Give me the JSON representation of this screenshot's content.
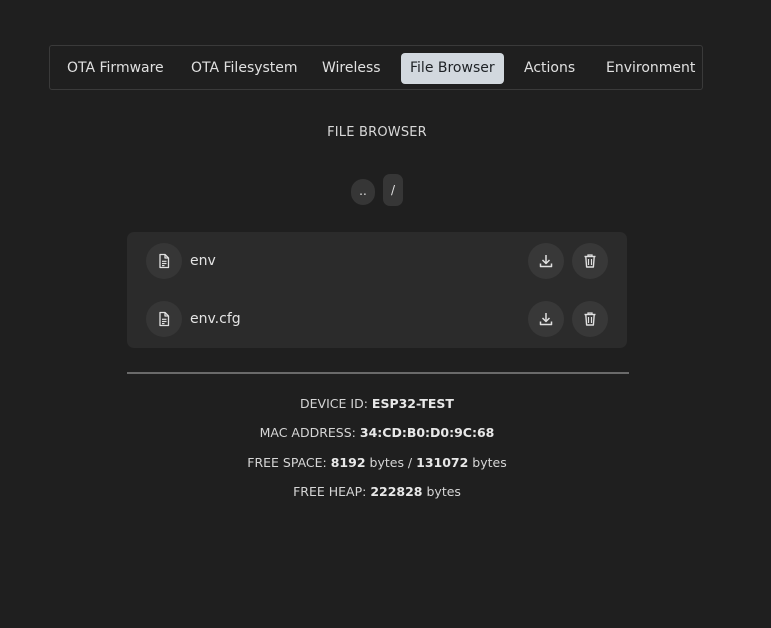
{
  "nav": {
    "tabs": [
      {
        "label": "OTA Firmware",
        "active": false
      },
      {
        "label": "OTA Filesystem",
        "active": false
      },
      {
        "label": "Wireless",
        "active": false
      },
      {
        "label": "File Browser",
        "active": true
      },
      {
        "label": "Actions",
        "active": false
      },
      {
        "label": "Environment",
        "active": false
      }
    ]
  },
  "browser": {
    "title": "FILE BROWSER",
    "breadcrumbs": {
      "up": "..",
      "root": "/"
    },
    "files": [
      {
        "name": "env",
        "icon": "file-text-icon"
      },
      {
        "name": "env.cfg",
        "icon": "file-text-icon"
      }
    ]
  },
  "info": {
    "device_id_label": "DEVICE ID:",
    "device_id": "ESP32-TEST",
    "mac_label": "MAC ADDRESS:",
    "mac": "34:CD:B0:D0:9C:68",
    "free_space_label": "FREE SPACE:",
    "free_space_used": "8192",
    "free_space_unit1": "bytes /",
    "free_space_total": "131072",
    "free_space_unit2": "bytes",
    "free_heap_label": "FREE HEAP:",
    "free_heap": "222828",
    "free_heap_unit": "bytes"
  },
  "colors": {
    "background": "#1f1f1f",
    "active_tab": "#d2d8de",
    "panel": "#2b2b2b"
  }
}
